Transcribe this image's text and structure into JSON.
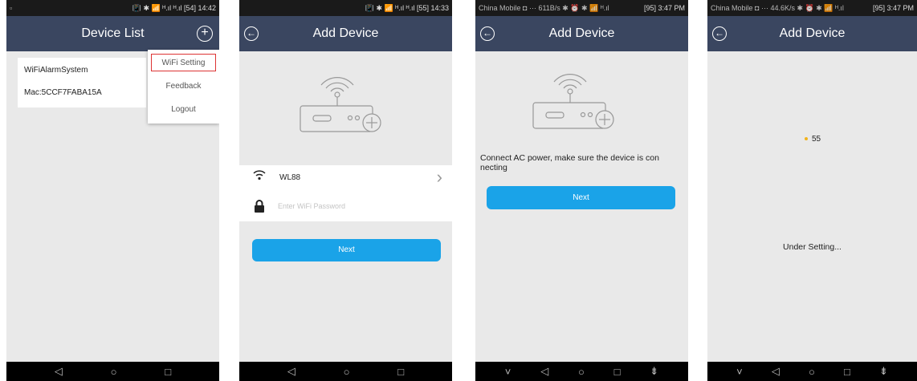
{
  "screens": [
    {
      "status_left": "▫",
      "status_right": "📳 ✱ 📶 ᴴ.ıl ᴴ.ıl [54] 14:42",
      "title": "Device List",
      "device": {
        "name": "WiFiAlarmSystem",
        "mac": "Mac:5CCF7FABA15A"
      },
      "menu": [
        "WiFi Setting",
        "Feedback",
        "Logout"
      ],
      "nav": [
        "◁",
        "○",
        "□"
      ]
    },
    {
      "status_left": "",
      "status_right": "📳 ✱ 📶 ᴴ.ıl ᴴ.ıl [55] 14:33",
      "title": "Add Device",
      "ssid": "WL88",
      "password_placeholder": "Enter WiFi Password",
      "next": "Next",
      "nav": [
        "◁",
        "○",
        "□"
      ]
    },
    {
      "status_left": "China Mobile ◘ ···   611B/s ✱ ⏰ ✱ 📶 ᴴ.ıl",
      "status_right": "[95] 3:47 PM",
      "title": "Add Device",
      "hint": "Connect AC power, make sure the device is con necting",
      "next": "Next",
      "nav": [
        "˅",
        "◁",
        "○",
        "□",
        "⇟"
      ]
    },
    {
      "status_left": "China Mobile ◘ ···   44.6K/s ✱ ⏰ ✱ 📶 ᴴ.ıl",
      "status_right": "[95] 3:47 PM",
      "title": "Add Device",
      "progress": "55",
      "status_text": "Under Setting...",
      "nav": [
        "˅",
        "◁",
        "○",
        "□",
        "⇟"
      ]
    }
  ],
  "colors": {
    "header": "#3a4660",
    "accent": "#1aa3e8",
    "highlight_border": "#d33333",
    "progress_dot": "#f2b31b"
  }
}
